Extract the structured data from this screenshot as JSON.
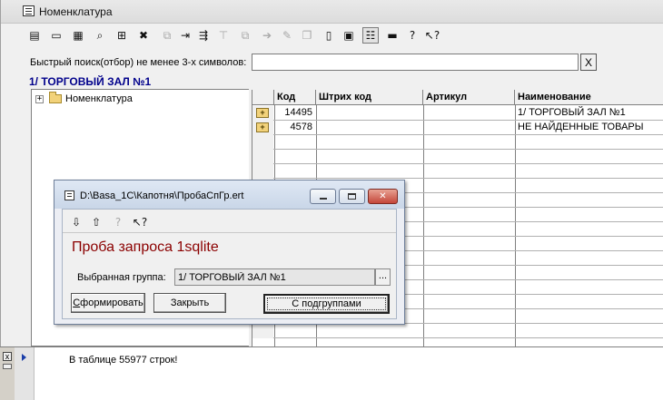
{
  "window": {
    "title": "Номенклатура",
    "toolbar_icons": [
      {
        "name": "new-list-icon",
        "glyph": "▤",
        "enabled": true
      },
      {
        "name": "new-folder-icon",
        "glyph": "▭",
        "enabled": true
      },
      {
        "name": "edit-icon",
        "glyph": "▦",
        "enabled": true
      },
      {
        "name": "search-doc-icon",
        "glyph": "⌕",
        "enabled": true
      },
      {
        "name": "add-row-icon",
        "glyph": "⊞",
        "enabled": true
      },
      {
        "name": "delete-icon",
        "glyph": "✖",
        "enabled": true
      },
      {
        "name": "copy-disabled-icon",
        "glyph": "⧉",
        "enabled": false
      },
      {
        "name": "move-to-group-icon",
        "glyph": "⇥",
        "enabled": true
      },
      {
        "name": "hierarchy-icon",
        "glyph": "⇶",
        "enabled": true
      },
      {
        "name": "filter-disabled-icon",
        "glyph": "⊤",
        "enabled": false
      },
      {
        "name": "duplicate-disabled-icon",
        "glyph": "⧉",
        "enabled": false
      },
      {
        "name": "arrow-disabled-icon",
        "glyph": "➔",
        "enabled": false
      },
      {
        "name": "tools-disabled-icon",
        "glyph": "✎",
        "enabled": false
      },
      {
        "name": "pages-disabled-icon",
        "glyph": "❐",
        "enabled": false
      },
      {
        "name": "document-icon",
        "glyph": "▯",
        "enabled": true
      },
      {
        "name": "report-icon",
        "glyph": "▣",
        "enabled": true
      },
      {
        "name": "tree-view-icon",
        "glyph": "☷",
        "enabled": true,
        "pressed": true
      },
      {
        "name": "monitor-icon",
        "glyph": "▬",
        "enabled": true
      },
      {
        "name": "help-icon",
        "glyph": "?",
        "enabled": true
      },
      {
        "name": "context-help-icon",
        "glyph": "↖?",
        "enabled": true
      }
    ]
  },
  "search": {
    "label": "Быстрый поиск(отбор) не менее 3-х символов:",
    "value": "",
    "clear_label": "X"
  },
  "breadcrumb": "1/ ТОРГОВЫЙ ЗАЛ №1",
  "tree": {
    "expander": "+",
    "root_label": "Номенклатура"
  },
  "grid": {
    "columns": [
      "Код",
      "Штрих код",
      "Артикул",
      "Наименование"
    ],
    "rows": [
      {
        "icon": "+",
        "code": "14495",
        "barcode": "",
        "article": "",
        "name": "1/ ТОРГОВЫЙ ЗАЛ №1"
      },
      {
        "icon": "+",
        "code": "4578",
        "barcode": "",
        "article": "",
        "name": "НЕ НАЙДЕННЫЕ ТОВАРЫ"
      }
    ]
  },
  "messages": {
    "close_label": "x",
    "text": "В таблице 55977 строк!"
  },
  "dialog": {
    "title": "D:\\Basa_1C\\Капотня\\ПробаСпГр.ert",
    "close_label": "✕",
    "tool_icons": [
      {
        "name": "move-down-icon",
        "glyph": "⇩",
        "enabled": true
      },
      {
        "name": "move-up-icon",
        "glyph": "⇧",
        "enabled": true
      },
      {
        "name": "help-disabled-icon",
        "glyph": "?",
        "enabled": false
      },
      {
        "name": "context-help-icon",
        "glyph": "↖?",
        "enabled": true
      }
    ],
    "heading": "Проба запроса 1sqlite",
    "group_label": "Выбранная группа:",
    "group_value": "1/ ТОРГОВЫЙ ЗАЛ №1",
    "group_pick_label": "...",
    "buttons": {
      "form_label_first": "С",
      "form_label_rest": "формировать",
      "close_label": "Закрыть",
      "subgroups_label": "С подгруппами"
    }
  }
}
